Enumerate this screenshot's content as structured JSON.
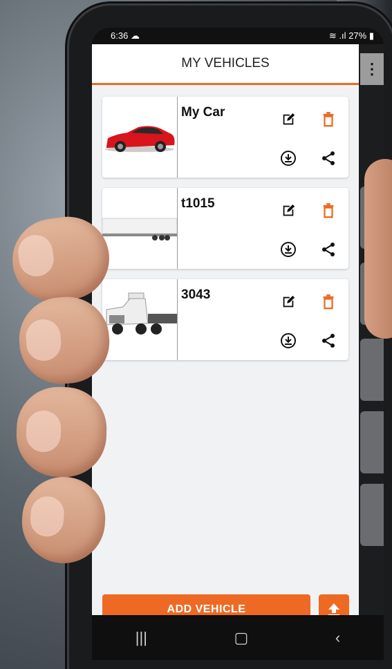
{
  "status": {
    "time": "6:36",
    "battery": "27%"
  },
  "appbar": {
    "title": "MY VEHICLES"
  },
  "vehicles": [
    {
      "name": "My Car",
      "image": "red-car"
    },
    {
      "name": "t1015",
      "image": "trailer"
    },
    {
      "name": "3043",
      "image": "semi-truck"
    }
  ],
  "footer": {
    "add_label": "ADD VEHICLE"
  },
  "colors": {
    "accent": "#ee6a24",
    "background": "#f1f2f4"
  }
}
